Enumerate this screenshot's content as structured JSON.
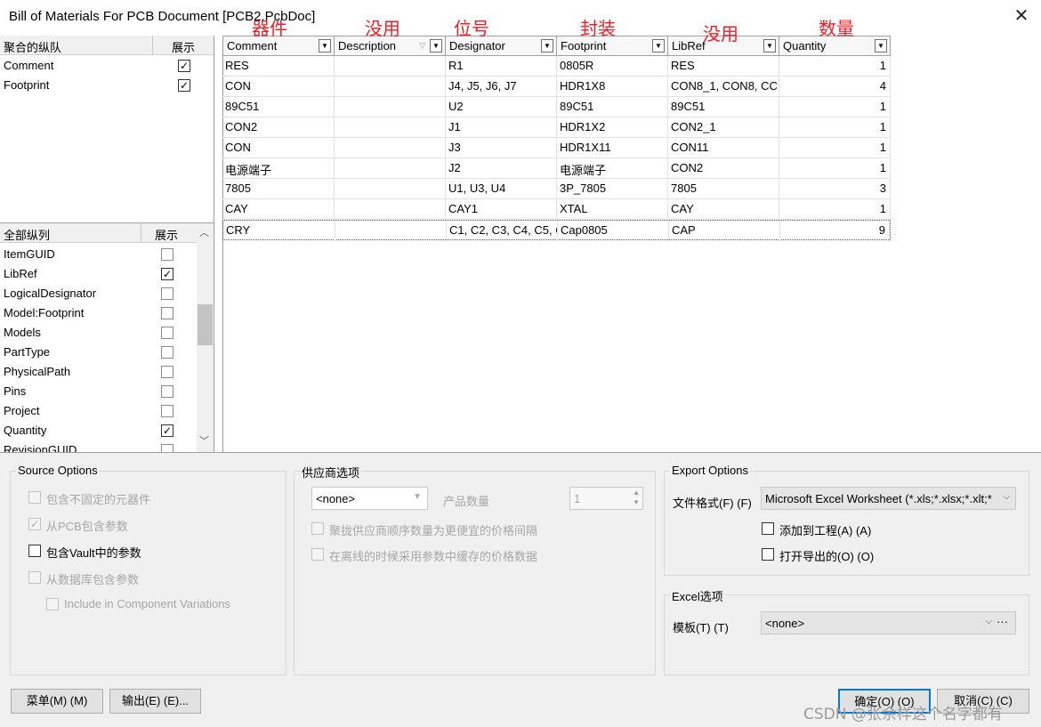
{
  "window": {
    "title": "Bill of Materials For PCB Document [PCB2.PcbDoc]",
    "close_glyph": "✕"
  },
  "annotations": [
    "器件",
    "没用",
    "位号",
    "封装",
    "没用",
    "数量"
  ],
  "grouped_panel": {
    "header_col1": "聚合的纵队",
    "header_col2": "展示",
    "rows": [
      {
        "label": "Comment",
        "checked": true
      },
      {
        "label": "Footprint",
        "checked": true
      }
    ]
  },
  "all_columns_panel": {
    "header_col1": "全部纵列",
    "header_col2": "展示",
    "rows": [
      {
        "label": "ItemGUID",
        "checked": false
      },
      {
        "label": "LibRef",
        "checked": true
      },
      {
        "label": "LogicalDesignator",
        "checked": false
      },
      {
        "label": "Model:Footprint",
        "checked": false
      },
      {
        "label": "Models",
        "checked": false
      },
      {
        "label": "PartType",
        "checked": false
      },
      {
        "label": "PhysicalPath",
        "checked": false
      },
      {
        "label": "Pins",
        "checked": false
      },
      {
        "label": "Project",
        "checked": false
      },
      {
        "label": "Quantity",
        "checked": true
      },
      {
        "label": "RevisionGUID",
        "checked": false
      }
    ],
    "scroll_up": "︿",
    "scroll_down": "﹀"
  },
  "grid": {
    "columns": [
      "Comment",
      "Description",
      "Designator",
      "Footprint",
      "LibRef",
      "Quantity"
    ],
    "rows": [
      [
        "RES",
        "",
        "R1",
        "0805R",
        "RES",
        "1"
      ],
      [
        "CON",
        "",
        "J4, J5, J6, J7",
        "HDR1X8",
        "CON8_1, CON8, CC",
        "4"
      ],
      [
        "89C51",
        "",
        "U2",
        "89C51",
        "89C51",
        "1"
      ],
      [
        "CON2",
        "",
        "J1",
        "HDR1X2",
        "CON2_1",
        "1"
      ],
      [
        "CON",
        "",
        "J3",
        "HDR1X11",
        "CON11",
        "1"
      ],
      [
        "电源端子",
        "",
        "J2",
        "电源端子",
        "CON2",
        "1"
      ],
      [
        "7805",
        "",
        "U1, U3, U4",
        "3P_7805",
        "7805",
        "3"
      ],
      [
        "CAY",
        "",
        "CAY1",
        "XTAL",
        "CAY",
        "1"
      ],
      [
        "CRY",
        "",
        "C1, C2, C3, C4, C5, C",
        "Cap0805",
        "CAP",
        "9"
      ]
    ]
  },
  "source_options": {
    "title": "Source Options",
    "items": [
      {
        "label": "包含不固定的元器件",
        "checked": false,
        "enabled": false
      },
      {
        "label": "从PCB包含参数",
        "checked": true,
        "enabled": false
      },
      {
        "label": "包含Vault中的参数",
        "checked": false,
        "enabled": true
      },
      {
        "label": "从数据库包含参数",
        "checked": false,
        "enabled": false
      },
      {
        "label": "Include in Component Variations",
        "checked": false,
        "enabled": false
      }
    ]
  },
  "supplier_options": {
    "title": "供应商选项",
    "combo_value": "<none>",
    "qty_label": "产品数量",
    "qty_value": "1",
    "items": [
      {
        "label": "聚拢供应商顺序数量为更便宜的价格间隔",
        "checked": false
      },
      {
        "label": "在离线的时候采用参数中缓存的价格数据",
        "checked": false
      }
    ]
  },
  "export_options": {
    "title": "Export Options",
    "format_label": "文件格式(F) (F)",
    "format_value": "Microsoft Excel Worksheet (*.xls;*.xlsx;*.xlt;*",
    "add_to_project": "添加到工程(A) (A)",
    "open_exported": "打开导出的(O) (O)"
  },
  "excel_options": {
    "title": "Excel选项",
    "template_label": "模板(T) (T)",
    "template_value": "<none>",
    "browse": "···"
  },
  "buttons": {
    "menu": "菜单(M) (M)",
    "export": "输出(E) (E)...",
    "ok": "确定(O) (O)",
    "cancel": "取消(C) (C)"
  },
  "watermark": "CSDN @张余样这个名字都有"
}
